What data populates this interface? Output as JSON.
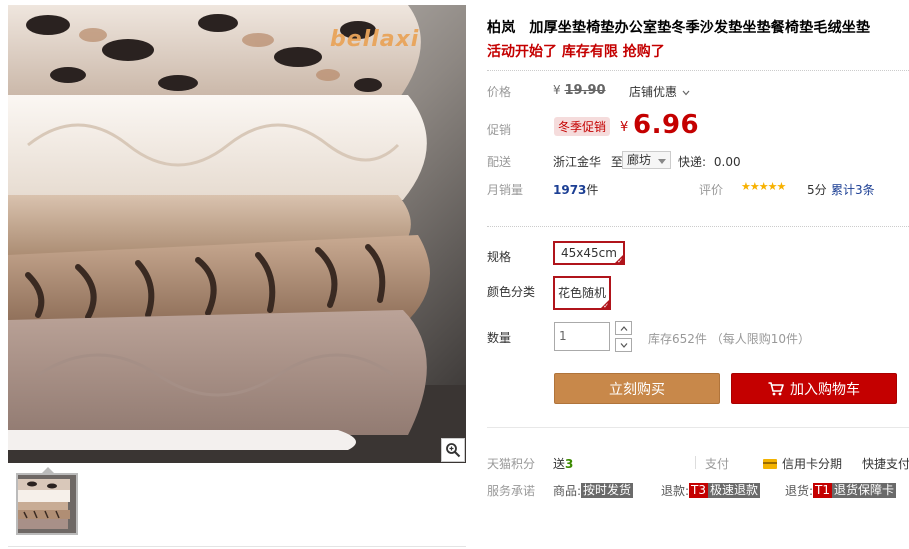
{
  "product": {
    "brand": "柏岚",
    "title": "加厚坐垫椅垫办公室垫冬季沙发垫坐垫餐椅垫毛绒坐垫",
    "subtitle": "活动开始了 库存有限 抢购了",
    "image_logo_text": "bellaxi"
  },
  "price": {
    "label": "价格",
    "currency": "¥",
    "original": "19.90",
    "shop_discount_label": "店铺优惠",
    "promo_label": "促销",
    "promo_tag": "冬季促销",
    "promo_currency": "¥",
    "promo_price": "6.96"
  },
  "shipping": {
    "label": "配送",
    "from": "浙江金华",
    "to_word": "至",
    "destination": "廊坊",
    "fee_label": "快递:",
    "fee": "0.00"
  },
  "sales": {
    "monthly_label": "月销量",
    "monthly_count": "1973",
    "monthly_unit": "件",
    "rating_label": "评价",
    "stars": "★★★★★",
    "score": "5分",
    "reviews": "累计3条"
  },
  "options": {
    "spec_label": "规格",
    "spec_value": "45x45cm",
    "color_label": "颜色分类",
    "color_value": "花色随机"
  },
  "quantity": {
    "label": "数量",
    "value": "1",
    "stock_text": "库存652件 （每人限购10件）"
  },
  "actions": {
    "buy_now": "立刻购买",
    "add_to_cart": "加入购物车"
  },
  "footer": {
    "points_label": "天猫积分",
    "points_prefix": "送",
    "points_value": "3",
    "pay_label": "支付",
    "credit_installment": "信用卡分期",
    "quick_pay": "快捷支付",
    "promise_label": "服务承诺",
    "goods_label": "商品:",
    "goods_badge": "按时发货",
    "refund_label": "退款:",
    "refund_badge_code": "T3",
    "refund_badge": "极速退款",
    "return_label": "退货:",
    "return_badge_code": "T1",
    "return_badge": "退货保障卡"
  },
  "colors": {
    "accent_red": "#c40000",
    "buy_button": "#c8884a",
    "link_blue": "#1c3f94",
    "star_gold": "#f7b100"
  },
  "icons": [
    "zoom-icon",
    "chevron-down-icon",
    "caret-down-icon",
    "arrow-up-icon",
    "arrow-down-icon",
    "cart-icon",
    "credit-card-icon",
    "check-icon"
  ]
}
